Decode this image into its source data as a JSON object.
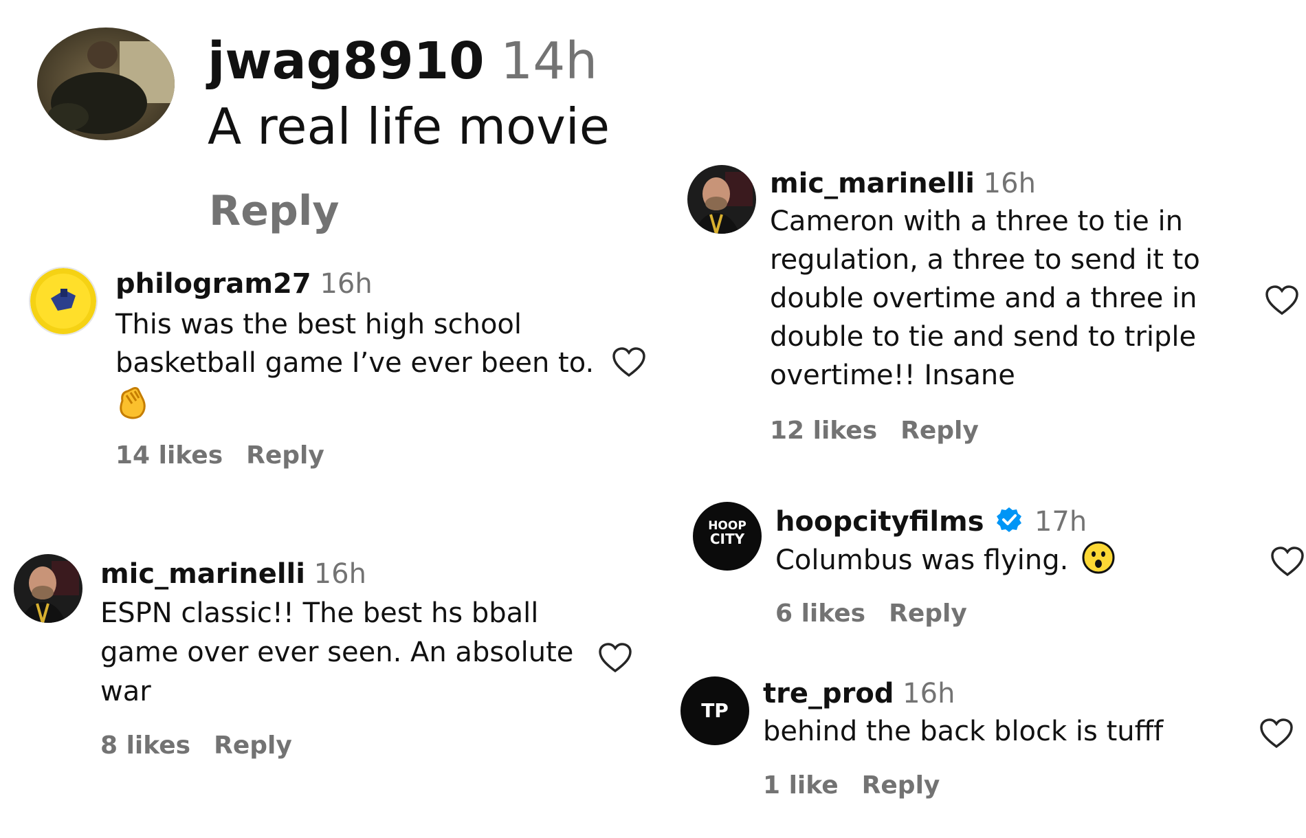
{
  "top_comment": {
    "username": "jwag8910",
    "time": "14h",
    "text": "A real life movie",
    "reply_label": "Reply",
    "avatar_icon": "person-photo-avatar"
  },
  "left_comments": [
    {
      "username": "philogram27",
      "time": "16h",
      "text_lines": [
        "This was the best high school",
        "basketball game I’ve ever been to."
      ],
      "emoji": "clapping-hands-emoji",
      "likes": "14 likes",
      "reply_label": "Reply",
      "avatar_icon": "yellow-logo-avatar"
    },
    {
      "username": "mic_marinelli",
      "time": "16h",
      "text_lines": [
        "ESPN classic!! The best hs bball",
        "game over ever seen. An absolute",
        "war"
      ],
      "likes": "8 likes",
      "reply_label": "Reply",
      "avatar_icon": "man-photo-avatar"
    }
  ],
  "right_comments": [
    {
      "username": "mic_marinelli",
      "time": "16h",
      "text_lines": [
        "Cameron with a three to tie in",
        "regulation, a three to send it to",
        "double overtime and a three in",
        "double to tie and send to triple",
        "overtime!! Insane"
      ],
      "likes": "12 likes",
      "reply_label": "Reply",
      "avatar_icon": "man-photo-avatar"
    },
    {
      "username": "hoopcityfilms",
      "verified": true,
      "time": "17h",
      "text": "Columbus was flying.",
      "emoji": "astonished-face-emoji",
      "likes": "6 likes",
      "reply_label": "Reply",
      "avatar_logo_lines": [
        "HOOP",
        "CITY"
      ],
      "avatar_icon": "hoop-city-logo-avatar"
    },
    {
      "username": "tre_prod",
      "time": "16h",
      "text": "behind the back block is tufff",
      "likes": "1 like",
      "reply_label": "Reply",
      "avatar_logo": "TP",
      "avatar_icon": "tp-logo-avatar"
    }
  ],
  "colors": {
    "text": "#111111",
    "muted": "#737373",
    "verified": "#0095f6"
  }
}
